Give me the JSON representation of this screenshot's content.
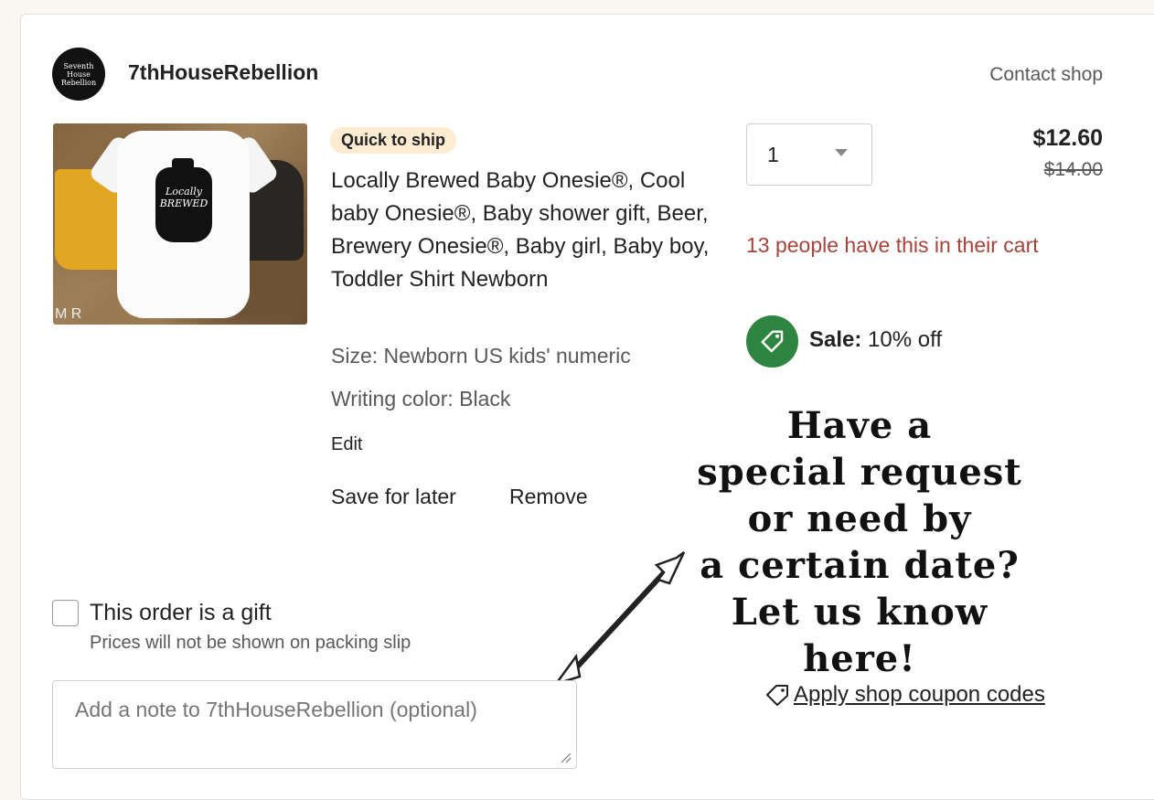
{
  "shop": {
    "logo_text": "Seventh\nHouse\nRebellion",
    "name": "7thHouseRebellion",
    "contact_label": "Contact shop"
  },
  "item": {
    "image_watermark": "M R",
    "image_text": "Locally\nBREWED",
    "badge": "Quick to ship",
    "title": "Locally Brewed Baby Onesie®, Cool baby Onesie®, Baby shower gift, Beer, Brewery Onesie®, Baby girl, Baby boy, Toddler Shirt Newborn",
    "size": "Size: Newborn US kids' numeric",
    "writing_color": "Writing color: Black",
    "edit_label": "Edit",
    "save_for_later_label": "Save for later",
    "remove_label": "Remove",
    "quantity": "1",
    "price": "$12.60",
    "original_price": "$14.00",
    "cart_note": "13 people have this in their cart",
    "sale_label": "Sale:",
    "sale_value": "10% off"
  },
  "promo": {
    "text": "Have a\nspecial request\nor need by\na certain date?\nLet us know here!"
  },
  "gift": {
    "label": "This order is a gift",
    "sublabel": "Prices will not be shown on packing slip",
    "checked": false
  },
  "note": {
    "placeholder": "Add a note to 7thHouseRebellion (optional)"
  },
  "coupon": {
    "label": "Apply shop coupon codes"
  },
  "colors": {
    "sale_green": "#2e8540",
    "badge_bg": "#fdebd2",
    "cart_note_red": "#a6443a"
  },
  "icons": [
    "tag-icon",
    "chevron-down-icon",
    "arrow-icon",
    "resize-grip-icon"
  ]
}
